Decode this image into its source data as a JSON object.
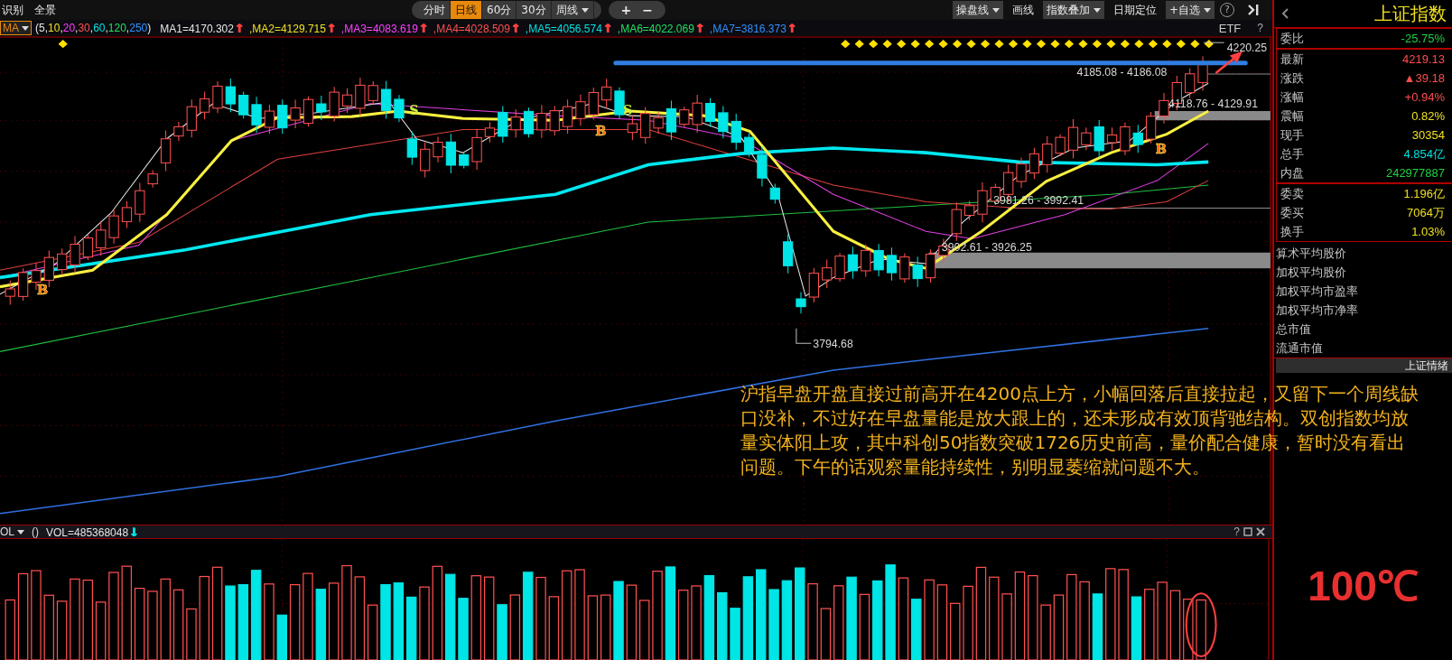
{
  "toolbar": {
    "left_items": [
      "识别",
      "全景"
    ],
    "periods": [
      {
        "label": "分时",
        "selected": false,
        "dropdown": false
      },
      {
        "label": "日线",
        "selected": true,
        "dropdown": false
      },
      {
        "label": "60分",
        "selected": false,
        "dropdown": false
      },
      {
        "label": "30分",
        "selected": false,
        "dropdown": false
      },
      {
        "label": "周线",
        "selected": false,
        "dropdown": true
      }
    ],
    "zoom_buttons": [
      "+",
      "−"
    ],
    "tools": [
      {
        "label": "操盘线",
        "dropdown": true
      },
      {
        "label": "画线",
        "dropdown": false
      },
      {
        "label": "指数叠加",
        "dropdown": true
      },
      {
        "label": "日期定位",
        "dropdown": false
      },
      {
        "label": "+自选",
        "dropdown": true
      }
    ],
    "help": "?"
  },
  "ma_legend": {
    "selector": "MA",
    "params": [
      {
        "text": "(5,",
        "color": "#e6e6e6"
      },
      {
        "text": "10",
        "color": "#f0e020"
      },
      {
        "text": ","
      },
      {
        "text": "20",
        "color": "#ff40ff"
      },
      {
        "text": ","
      },
      {
        "text": "30",
        "color": "#ff5050"
      },
      {
        "text": ","
      },
      {
        "text": "60",
        "color": "#00e0e0"
      },
      {
        "text": ","
      },
      {
        "text": "120",
        "color": "#20e060"
      },
      {
        "text": ","
      },
      {
        "text": "250",
        "color": "#3090ff"
      },
      {
        "text": ")"
      }
    ],
    "lines": [
      [
        {
          "text": "MA1=4170.302",
          "color": "#e6e6e6"
        },
        {
          "text": "↑",
          "color": "#ff4040"
        }
      ],
      [
        {
          "text": ",MA2=4129.715",
          "color": "#f0e020"
        },
        {
          "text": "↑",
          "color": "#ff4040"
        }
      ],
      [
        {
          "text": ",MA3=4083.619",
          "color": "#ff40ff"
        },
        {
          "text": "↑",
          "color": "#ff4040"
        }
      ],
      [
        {
          "text": ",MA4=4028.509",
          "color": "#ff5050"
        },
        {
          "text": "↑",
          "color": "#ff4040"
        }
      ],
      [
        {
          "text": ",MA5=4056.574",
          "color": "#00e0e0"
        },
        {
          "text": "↑",
          "color": "#ff4040"
        }
      ],
      [
        {
          "text": ",MA6=4022.069",
          "color": "#20e060"
        },
        {
          "text": "↑",
          "color": "#ff4040"
        }
      ],
      [
        {
          "text": ",MA7=3816.373",
          "color": "#3090ff"
        },
        {
          "text": "↑",
          "color": "#ff4040"
        }
      ]
    ],
    "etf": "ETF",
    "help": "?"
  },
  "chart": {
    "labels": [
      {
        "kind": "price",
        "text": "4220.25"
      },
      {
        "kind": "range_top",
        "text": "4185.08 - 4186.08"
      },
      {
        "kind": "range_upper",
        "text": "4118.76 - 4129.91"
      },
      {
        "kind": "range_middle",
        "text": "3981.26 - 3992.41"
      },
      {
        "kind": "range_lower",
        "text": "3902.61 - 3926.25"
      },
      {
        "kind": "low",
        "text": "3794.68"
      }
    ],
    "signals": [
      {
        "kind": "buy",
        "text": "B"
      },
      {
        "kind": "sell",
        "text": "S"
      },
      {
        "kind": "buy",
        "text": "B"
      },
      {
        "kind": "sell",
        "text": "S"
      },
      {
        "kind": "buy",
        "text": "B"
      }
    ],
    "annotation": "沪指早盘开盘直接过前高开在4200点上方，小幅回落后直接拉起，又留下一个周线缺口没补，不过好在早盘量能是放大跟上的，还未形成有效顶背驰结构。双创指数均放量实体阳上攻，其中科创50指数突破1726历史前高，量价配合健康，暂时没有看出问题。下午的话观察量能持续性，别明显萎缩就问题不大。"
  },
  "volume": {
    "selector": "OL",
    "params": "()",
    "value": [
      {
        "text": "VOL=485368048",
        "color": "#e6e6e6"
      },
      {
        "text": "↓",
        "color": "#00e0e0"
      }
    ],
    "help": "?"
  },
  "quote": {
    "title": "上证指数",
    "ratio": {
      "label": "委比",
      "value": "-25.75%",
      "color": "#20d040"
    },
    "main": [
      {
        "label": "最新",
        "value": "4219.13",
        "color": "#ff4d4d"
      },
      {
        "label": "涨跌",
        "value": "▲39.18",
        "color": "#ff4d4d"
      },
      {
        "label": "涨幅",
        "value": "+0.94%",
        "color": "#ff4d4d"
      },
      {
        "label": "震幅",
        "value": "0.82%",
        "color": "#f0e020"
      },
      {
        "label": "现手",
        "value": "30354",
        "color": "#f0e020"
      },
      {
        "label": "总手",
        "value": "4.854亿",
        "color": "#00e0e0"
      },
      {
        "label": "内盘",
        "value": "242977887",
        "color": "#20d040"
      }
    ],
    "orders": [
      {
        "label": "委卖",
        "value": "1.196亿",
        "color": "#f0e020"
      },
      {
        "label": "委买",
        "value": "7064万",
        "color": "#f0e020"
      },
      {
        "label": "换手",
        "value": "1.03%",
        "color": "#f0e020"
      }
    ],
    "stats": [
      "算术平均股价",
      "加权平均股价",
      "加权平均市盈率",
      "加权平均市净率",
      "总市值",
      "流通市值"
    ],
    "sentiment_title": "上证情绪",
    "temperature": "100℃"
  }
}
